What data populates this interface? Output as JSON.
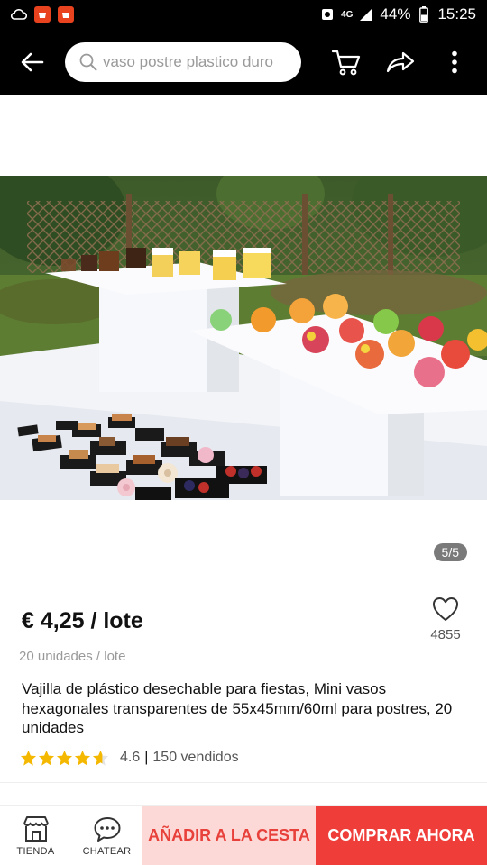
{
  "status_bar": {
    "network": "4G",
    "battery": "44%",
    "time": "15:25"
  },
  "header": {
    "search_text": "vaso postre plastico duro"
  },
  "gallery": {
    "counter": "5/5"
  },
  "product": {
    "price": "€ 4,25 / lote",
    "units": "20 unidades / lote",
    "title": "Vajilla de plástico desechable para fiestas, Mini vasos hexagonales transparentes de 55x45mm/60ml para postres, 20 unidades",
    "rating": "4.6",
    "rating_stars": 4.6,
    "separator": "|",
    "sold": "150 vendidos",
    "wishlist_count": "4855"
  },
  "bottom_bar": {
    "store_label": "TIENDA",
    "chat_label": "CHATEAR",
    "add_to_cart": "AÑADIR A LA CESTA",
    "buy_now": "COMPRAR AHORA"
  },
  "colors": {
    "accent": "#ef3e3a",
    "accent_light": "#fcd9d6",
    "star": "#f5b800",
    "header_bg": "#000000"
  },
  "icons": [
    "back-arrow-icon",
    "search-icon",
    "cart-icon",
    "share-icon",
    "more-vertical-icon",
    "heart-icon",
    "star-icon",
    "store-icon",
    "chat-icon"
  ]
}
